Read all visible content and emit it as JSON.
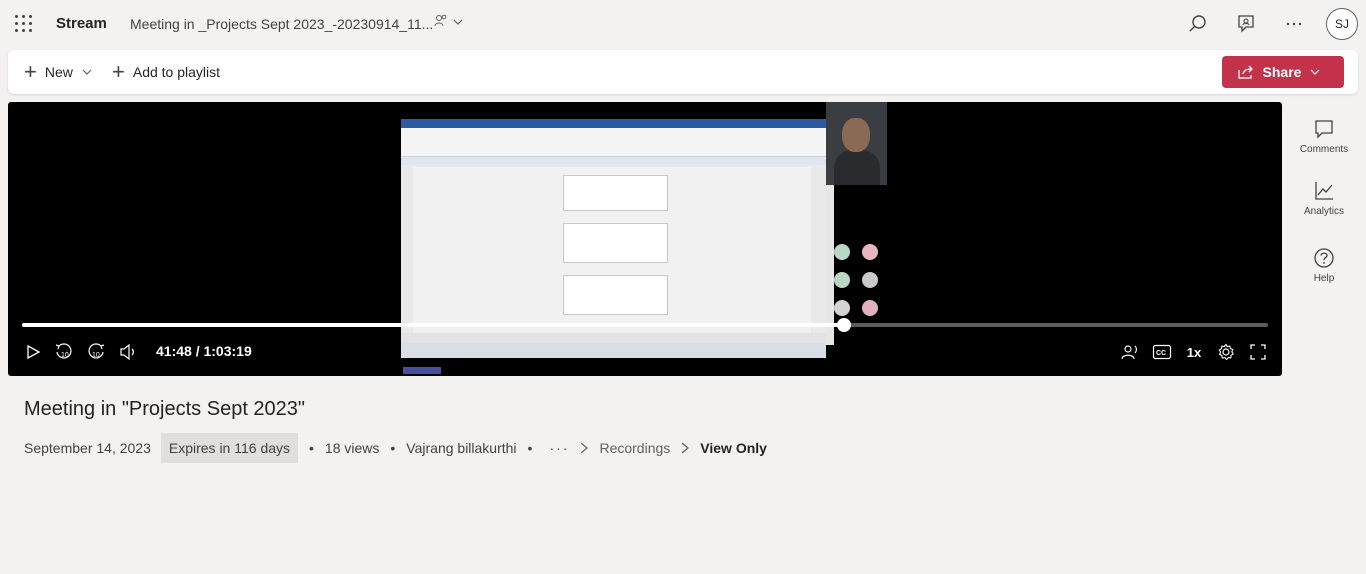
{
  "app": {
    "name": "Stream",
    "document_title": "Meeting in _Projects Sept 2023_-20230914_11...",
    "user_initials": "SJ"
  },
  "topbar": {
    "icons": [
      "waffle-icon",
      "people-icon",
      "chevron-down-icon",
      "search-icon",
      "feedback-icon",
      "more-icon"
    ]
  },
  "commands": {
    "new_label": "New",
    "add_to_playlist_label": "Add to playlist",
    "share_label": "Share"
  },
  "player": {
    "current_time": "41:48",
    "duration": "1:03:19",
    "time_display": "41:48 / 1:03:19",
    "progress": 0.66,
    "buffered": 0.69,
    "speed": "1x",
    "skip_back_seconds": "10",
    "skip_forward_seconds": "10"
  },
  "rail": {
    "comments_label": "Comments",
    "analytics_label": "Analytics",
    "help_label": "Help"
  },
  "video": {
    "title": "Meeting in \"Projects Sept 2023\"",
    "date": "September 14, 2023",
    "expires": "Expires in 116 days",
    "views": "18 views",
    "owner": "Vajrang billakurthi",
    "breadcrumb_parent": "Recordings",
    "breadcrumb_current": "View Only"
  },
  "colors": {
    "accent": "#c4314b",
    "background": "#f3f2f1",
    "player_bg": "#000000"
  }
}
